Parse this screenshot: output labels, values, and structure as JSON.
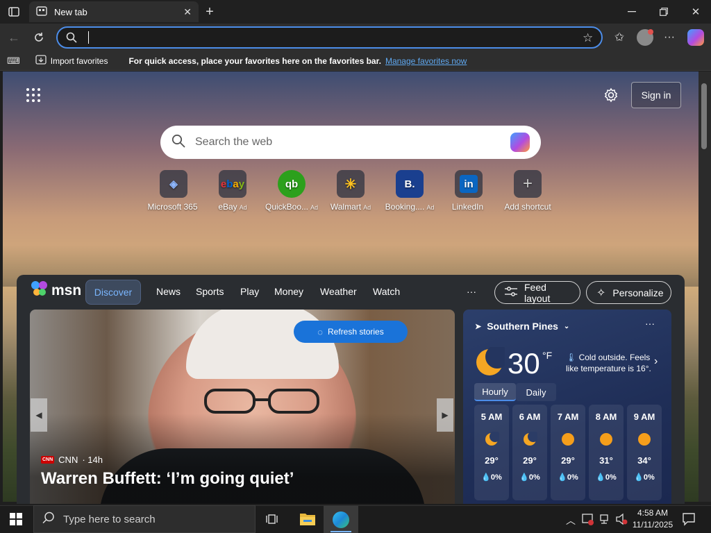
{
  "browser": {
    "tab_title": "New tab",
    "address_value": "",
    "favbar": {
      "import_label": "Import favorites",
      "message": "For quick access, place your favorites here on the favorites bar.",
      "manage_link": "Manage favorites now"
    }
  },
  "newtab": {
    "sign_in": "Sign in",
    "search_placeholder": "Search the web",
    "shortcuts": [
      {
        "label": "Microsoft 365",
        "ad": "",
        "icon": "microsoft-365-icon",
        "color": "#3b3b46"
      },
      {
        "label": "eBay",
        "ad": "Ad",
        "icon": "ebay-icon",
        "color": "#3b3b46"
      },
      {
        "label": "QuickBoo...",
        "ad": "Ad",
        "icon": "quickbooks-icon",
        "color": "#2ca01c"
      },
      {
        "label": "Walmart",
        "ad": "Ad",
        "icon": "walmart-icon",
        "color": "#1c4f9c"
      },
      {
        "label": "Booking....",
        "ad": "Ad",
        "icon": "booking-icon",
        "color": "#1a3f8f"
      },
      {
        "label": "LinkedIn",
        "ad": "",
        "icon": "linkedin-icon",
        "color": "#0a66c2"
      },
      {
        "label": "Add shortcut",
        "ad": "",
        "icon": "plus-icon",
        "color": "#5a5a5a"
      }
    ]
  },
  "msn": {
    "logo": "msn",
    "tabs": [
      "Discover",
      "News",
      "Sports",
      "Play",
      "Money",
      "Weather",
      "Watch"
    ],
    "more": "···",
    "feed_layout": "Feed layout",
    "personalize": "Personalize",
    "refresh": "Refresh stories",
    "story": {
      "source": "CNN",
      "age": "· 14h",
      "headline": "Warren Buffett: ‘I’m going quiet’"
    },
    "weather": {
      "location": "Southern Pines",
      "temp": "30",
      "unit": "°F",
      "message": "Cold outside. Feels like temperature is 16°.",
      "tabs": [
        "Hourly",
        "Daily"
      ],
      "hours": [
        {
          "time": "5 AM",
          "icon": "moon-icon",
          "temp": "29°",
          "precip": "0%"
        },
        {
          "time": "6 AM",
          "icon": "moon-icon",
          "temp": "29°",
          "precip": "0%"
        },
        {
          "time": "7 AM",
          "icon": "sun-icon",
          "temp": "29°",
          "precip": "0%"
        },
        {
          "time": "8 AM",
          "icon": "sun-icon",
          "temp": "31°",
          "precip": "0%"
        },
        {
          "time": "9 AM",
          "icon": "sun-icon",
          "temp": "34°",
          "precip": "0%"
        }
      ]
    }
  },
  "taskbar": {
    "search_placeholder": "Type here to search",
    "time": "4:58 AM",
    "date": "11/11/2025"
  },
  "colors": {
    "accent": "#4c8de9",
    "refresh_button": "#1a73d9"
  }
}
